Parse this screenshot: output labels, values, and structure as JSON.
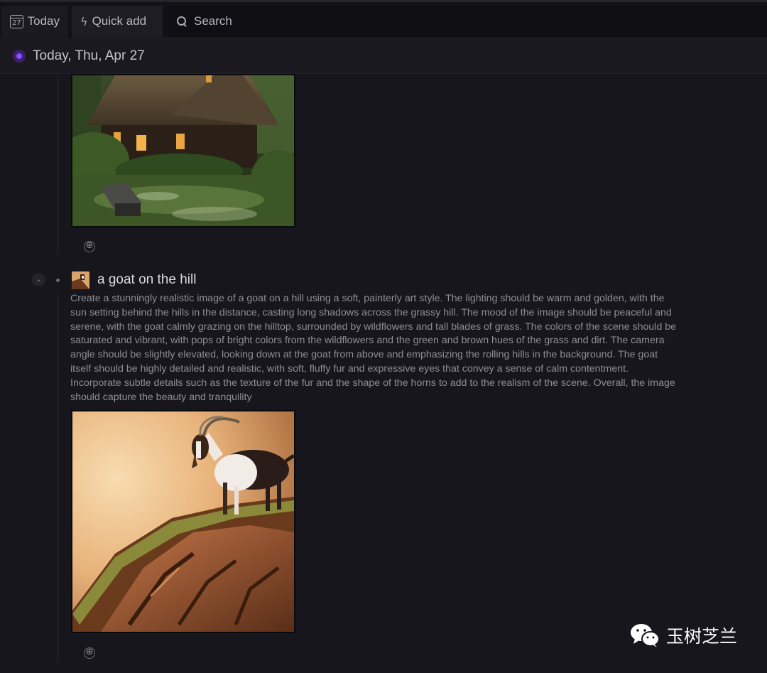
{
  "toolbar": {
    "today_label": "Today",
    "today_icon_day": "27",
    "quick_add_label": "Quick add",
    "search_label": "Search"
  },
  "date_header": {
    "title": "Today, Thu, Apr 27",
    "accent_color": "#8a4dff"
  },
  "entry": {
    "title": "a goat on the hill",
    "description": "Create a stunningly realistic image of a goat on a hill using a soft, painterly art style. The lighting should be warm and golden, with the sun setting behind the hills in the distance, casting long shadows across the grassy hill. The mood of the image should be peaceful and serene, with the goat calmly grazing on the hilltop, surrounded by wildflowers and tall blades of grass. The colors of the scene should be saturated and vibrant, with pops of bright colors from the wildflowers and the green and brown hues of the grass and dirt. The camera angle should be slightly elevated, looking down at the goat from above and emphasizing the rolling hills in the background. The goat itself should be highly detailed and realistic, with soft, fluffy fur and expressive eyes that convey a sense of calm contentment. Incorporate subtle details such as the texture of the fur and the shape of the horns to add to the realism of the scene. Overall, the image should capture the beauty and tranquility"
  },
  "icons": {
    "add": "⊕",
    "collapse": "⌄",
    "bolt": "ϟ"
  },
  "watermark": {
    "text": "玉树芝兰"
  }
}
